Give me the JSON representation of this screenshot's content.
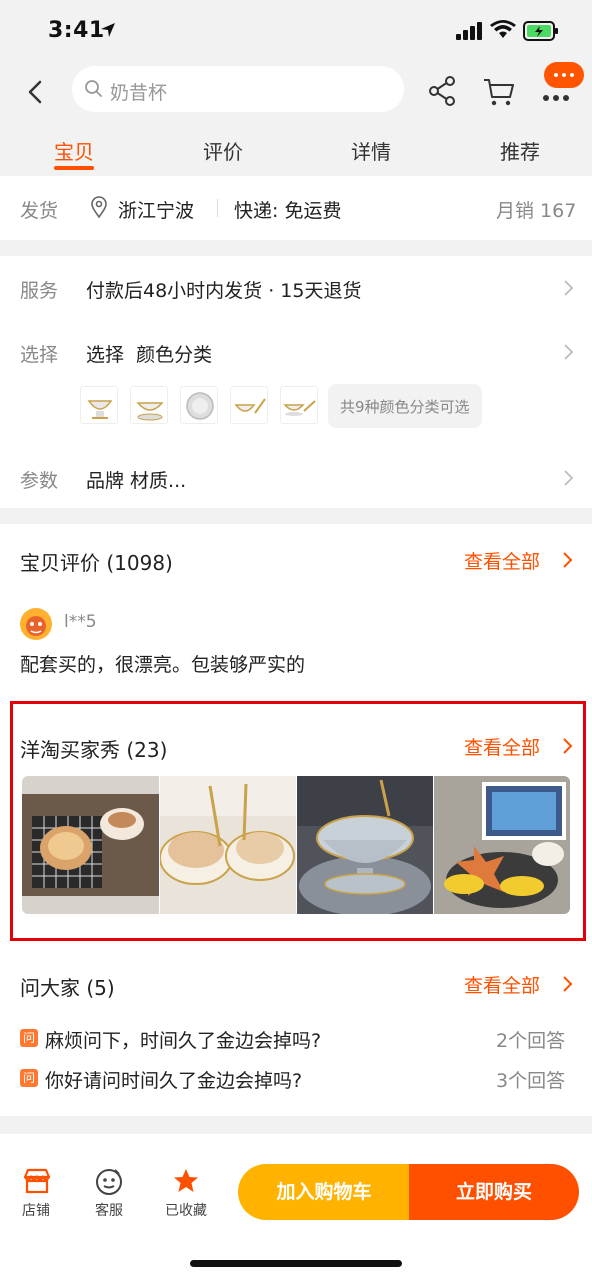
{
  "status_bar": {
    "time": "3:41"
  },
  "header": {
    "search_placeholder": "奶昔杯"
  },
  "tabs": [
    {
      "label": "宝贝",
      "active": true
    },
    {
      "label": "评价"
    },
    {
      "label": "详情"
    },
    {
      "label": "推荐"
    }
  ],
  "shipping": {
    "label": "发货",
    "location": "浙江宁波",
    "express": "快递: 免运费",
    "monthly_sales": "月销 167"
  },
  "service": {
    "label": "服务",
    "text": "付款后48小时内发货 · 15天退货"
  },
  "select": {
    "label": "选择",
    "text": "选择  颜色分类",
    "options_hint": "共9种颜色分类可选"
  },
  "params": {
    "label": "参数",
    "text": "品牌 材质..."
  },
  "reviews": {
    "title": "宝贝评价 (1098)",
    "view_all": "查看全部",
    "user": "l**5",
    "content": "配套买的，很漂亮。包装够严实的"
  },
  "buyer_show": {
    "title": "洋淘买家秀 (23)",
    "view_all": "查看全部"
  },
  "qa": {
    "title": "问大家 (5)",
    "view_all": "查看全部",
    "badge": "问",
    "items": [
      {
        "question": "麻烦问下，时间久了金边会掉吗?",
        "answers": "2个回答"
      },
      {
        "question": "你好请问时间久了金边会掉吗?",
        "answers": "3个回答"
      }
    ]
  },
  "bottom_bar": {
    "shop": "店铺",
    "service": "客服",
    "favorite": "已收藏",
    "add_to_cart": "加入购物车",
    "buy_now": "立即购买"
  },
  "colors": {
    "accent": "#ff5000",
    "cart_button": "#ffb300",
    "frame": "#e3000b"
  }
}
